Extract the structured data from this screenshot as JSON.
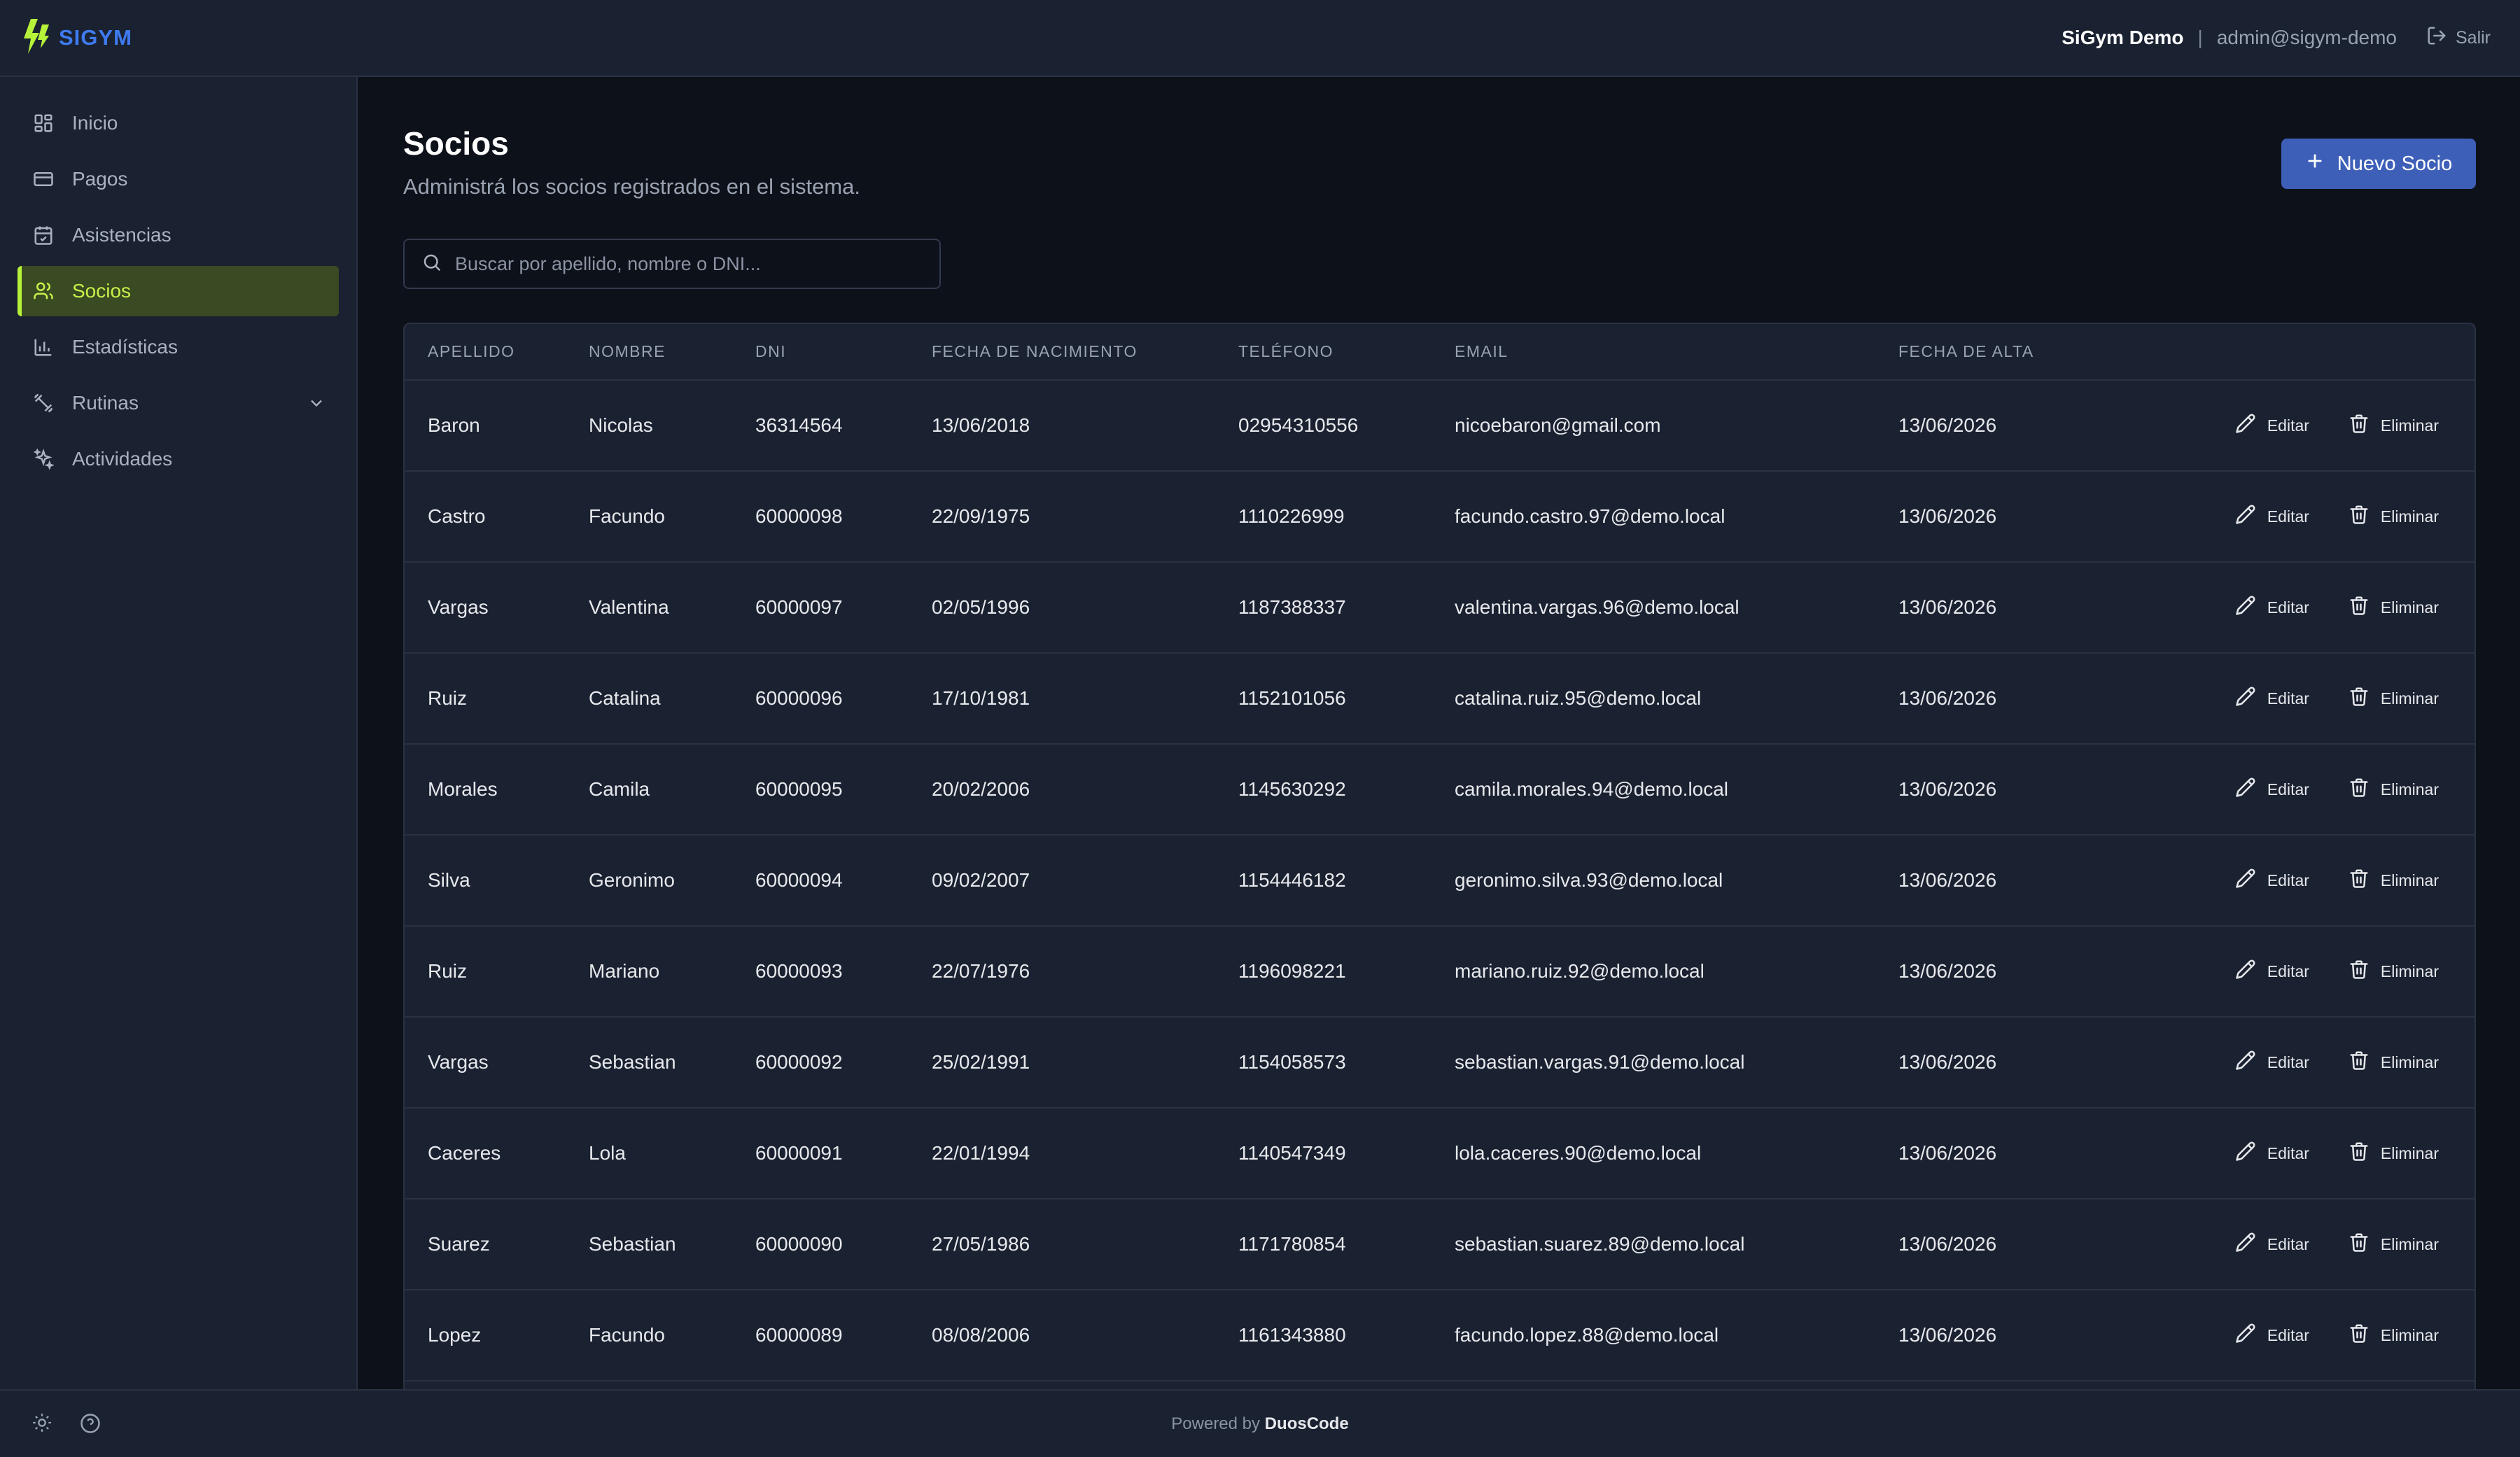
{
  "brand": {
    "name": "SIGYM",
    "accent": "#3f7bf0",
    "logo_color": "#b6f23a"
  },
  "header": {
    "user": "SiGym Demo",
    "separator": "|",
    "email": "admin@sigym-demo",
    "logout_label": "Salir"
  },
  "sidebar": {
    "items": [
      {
        "label": "Inicio",
        "icon": "dashboard-icon"
      },
      {
        "label": "Pagos",
        "icon": "credit-card-icon"
      },
      {
        "label": "Asistencias",
        "icon": "calendar-check-icon"
      },
      {
        "label": "Socios",
        "icon": "users-icon",
        "active": true
      },
      {
        "label": "Estadísticas",
        "icon": "bar-chart-icon"
      },
      {
        "label": "Rutinas",
        "icon": "dumbbell-icon",
        "expandable": true
      },
      {
        "label": "Actividades",
        "icon": "sparkles-icon"
      }
    ]
  },
  "page": {
    "title": "Socios",
    "subtitle": "Administrá los socios registrados en el sistema.",
    "new_button": "Nuevo Socio"
  },
  "search": {
    "placeholder": "Buscar por apellido, nombre o DNI...",
    "value": ""
  },
  "table": {
    "columns": [
      "APELLIDO",
      "NOMBRE",
      "DNI",
      "FECHA DE NACIMIENTO",
      "TELÉFONO",
      "EMAIL",
      "FECHA DE ALTA"
    ],
    "edit_label": "Editar",
    "delete_label": "Eliminar",
    "rows": [
      [
        "Baron",
        "Nicolas",
        "36314564",
        "13/06/2018",
        "02954310556",
        "nicoebaron@gmail.com",
        "13/06/2026"
      ],
      [
        "Castro",
        "Facundo",
        "60000098",
        "22/09/1975",
        "1110226999",
        "facundo.castro.97@demo.local",
        "13/06/2026"
      ],
      [
        "Vargas",
        "Valentina",
        "60000097",
        "02/05/1996",
        "1187388337",
        "valentina.vargas.96@demo.local",
        "13/06/2026"
      ],
      [
        "Ruiz",
        "Catalina",
        "60000096",
        "17/10/1981",
        "1152101056",
        "catalina.ruiz.95@demo.local",
        "13/06/2026"
      ],
      [
        "Morales",
        "Camila",
        "60000095",
        "20/02/2006",
        "1145630292",
        "camila.morales.94@demo.local",
        "13/06/2026"
      ],
      [
        "Silva",
        "Geronimo",
        "60000094",
        "09/02/2007",
        "1154446182",
        "geronimo.silva.93@demo.local",
        "13/06/2026"
      ],
      [
        "Ruiz",
        "Mariano",
        "60000093",
        "22/07/1976",
        "1196098221",
        "mariano.ruiz.92@demo.local",
        "13/06/2026"
      ],
      [
        "Vargas",
        "Sebastian",
        "60000092",
        "25/02/1991",
        "1154058573",
        "sebastian.vargas.91@demo.local",
        "13/06/2026"
      ],
      [
        "Caceres",
        "Lola",
        "60000091",
        "22/01/1994",
        "1140547349",
        "lola.caceres.90@demo.local",
        "13/06/2026"
      ],
      [
        "Suarez",
        "Sebastian",
        "60000090",
        "27/05/1986",
        "1171780854",
        "sebastian.suarez.89@demo.local",
        "13/06/2026"
      ],
      [
        "Lopez",
        "Facundo",
        "60000089",
        "08/08/2006",
        "1161343880",
        "facundo.lopez.88@demo.local",
        "13/06/2026"
      ],
      [
        "",
        "",
        "",
        "",
        "",
        "",
        ""
      ]
    ]
  },
  "footer": {
    "powered_prefix": "Powered by",
    "powered_brand": "DuosCode"
  }
}
